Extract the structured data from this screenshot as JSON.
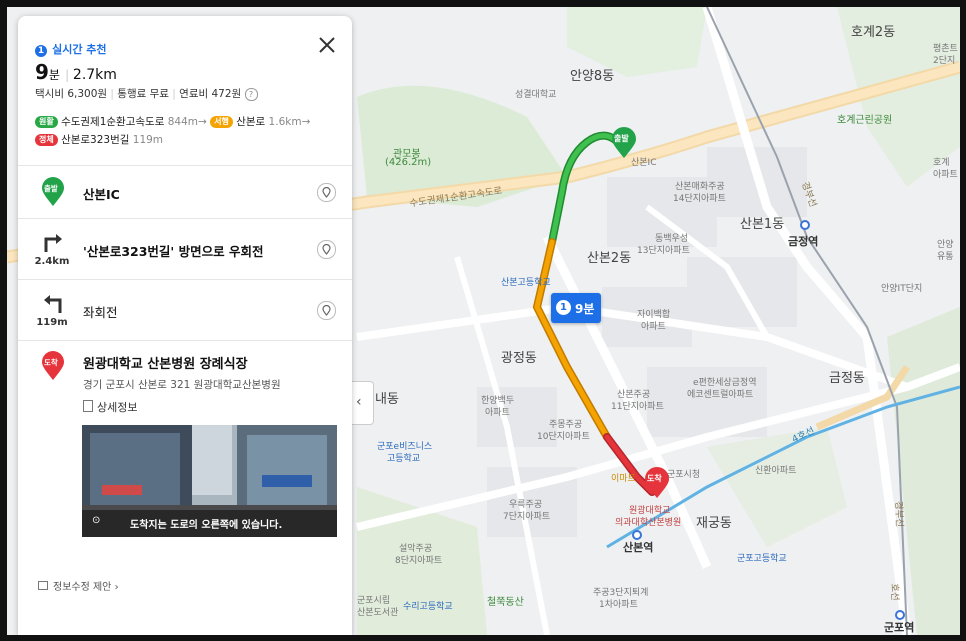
{
  "map": {
    "district_labels": [
      "호계2동",
      "안양8동",
      "산본1동",
      "산본2동",
      "광정동",
      "금정동",
      "재궁동",
      "내동"
    ],
    "station_labels": [
      "금정역",
      "산본역",
      "군포역"
    ],
    "place_labels": [
      "성결대학교",
      "관모봉",
      "(426.2m)",
      "호계근린공원",
      "산본IC",
      "산본매화주공",
      "14단지아파트",
      "동백우성",
      "13단지아파트",
      "산본고등학교",
      "자이백합",
      "아파트",
      "한양백두",
      "아파트",
      "주몽주공",
      "10단지아파트",
      "산본주공",
      "11단지아파트",
      "e편한세상금정역",
      "에코센트럴아파트",
      "군포e비즈니스",
      "고등학교",
      "이마트",
      "군포시청",
      "신환아파트",
      "우륵주공",
      "7단지아파트",
      "원광대학교",
      "의과대학산본병원",
      "설악주공",
      "8단지아파트",
      "군포고등학교",
      "주공3단지퇴계",
      "1차아파트",
      "수리고등학교",
      "철쭉동산",
      "군포시립",
      "산본도서관",
      "안양IT단지",
      "평촌트",
      "2단지",
      "호계",
      "아파트",
      "안양",
      "유통"
    ],
    "road_labels": [
      "수도권제1순환고속도로",
      "경부선",
      "경부선",
      "4호선",
      "호선"
    ],
    "marker_start": "출발",
    "marker_end": "도착",
    "route_badge_num": "1",
    "route_badge_time": "9분"
  },
  "panel": {
    "recommend_num": "1",
    "recommend_label": "실시간 추천",
    "time_value": "9",
    "time_unit": "분",
    "distance": "2.7km",
    "costs": {
      "taxi": "택시비 6,300원",
      "toll": "통행료 무료",
      "fuel": "연료비 472원",
      "help_icon": "?"
    },
    "segments": [
      {
        "status": "원활",
        "color": "#27a845",
        "road": "수도권제1순환고속도로",
        "dist": "844m",
        "arrow": "→"
      },
      {
        "status": "서행",
        "color": "#f5a300",
        "road": "산본로",
        "dist": "1.6km",
        "arrow": "→"
      },
      {
        "status": "정체",
        "color": "#e5343b",
        "road": "산본로323번길",
        "dist": "119m",
        "arrow": ""
      }
    ],
    "steps": [
      {
        "badge": "출발",
        "title": "산본IC",
        "dist": ""
      },
      {
        "badge": "",
        "title": "'산본로323번길' 방면으로 우회전",
        "dist": "2.4km"
      },
      {
        "badge": "",
        "title": "좌회전",
        "dist": "119m"
      }
    ],
    "destination": {
      "badge": "도착",
      "name": "원광대학교 산본병원 장례식장",
      "address": "경기 군포시 산본로 321 원광대학교산본병원",
      "detail_link": "상세정보",
      "street_caption": "도착지는 도로의 오른쪽에 있습니다."
    },
    "feedback": "정보수정 제안",
    "feedback_arrow": "›"
  },
  "colors": {
    "accent": "#1c6fe6",
    "smooth": "#27a845",
    "slow": "#f5a300",
    "jam": "#e5343b"
  }
}
